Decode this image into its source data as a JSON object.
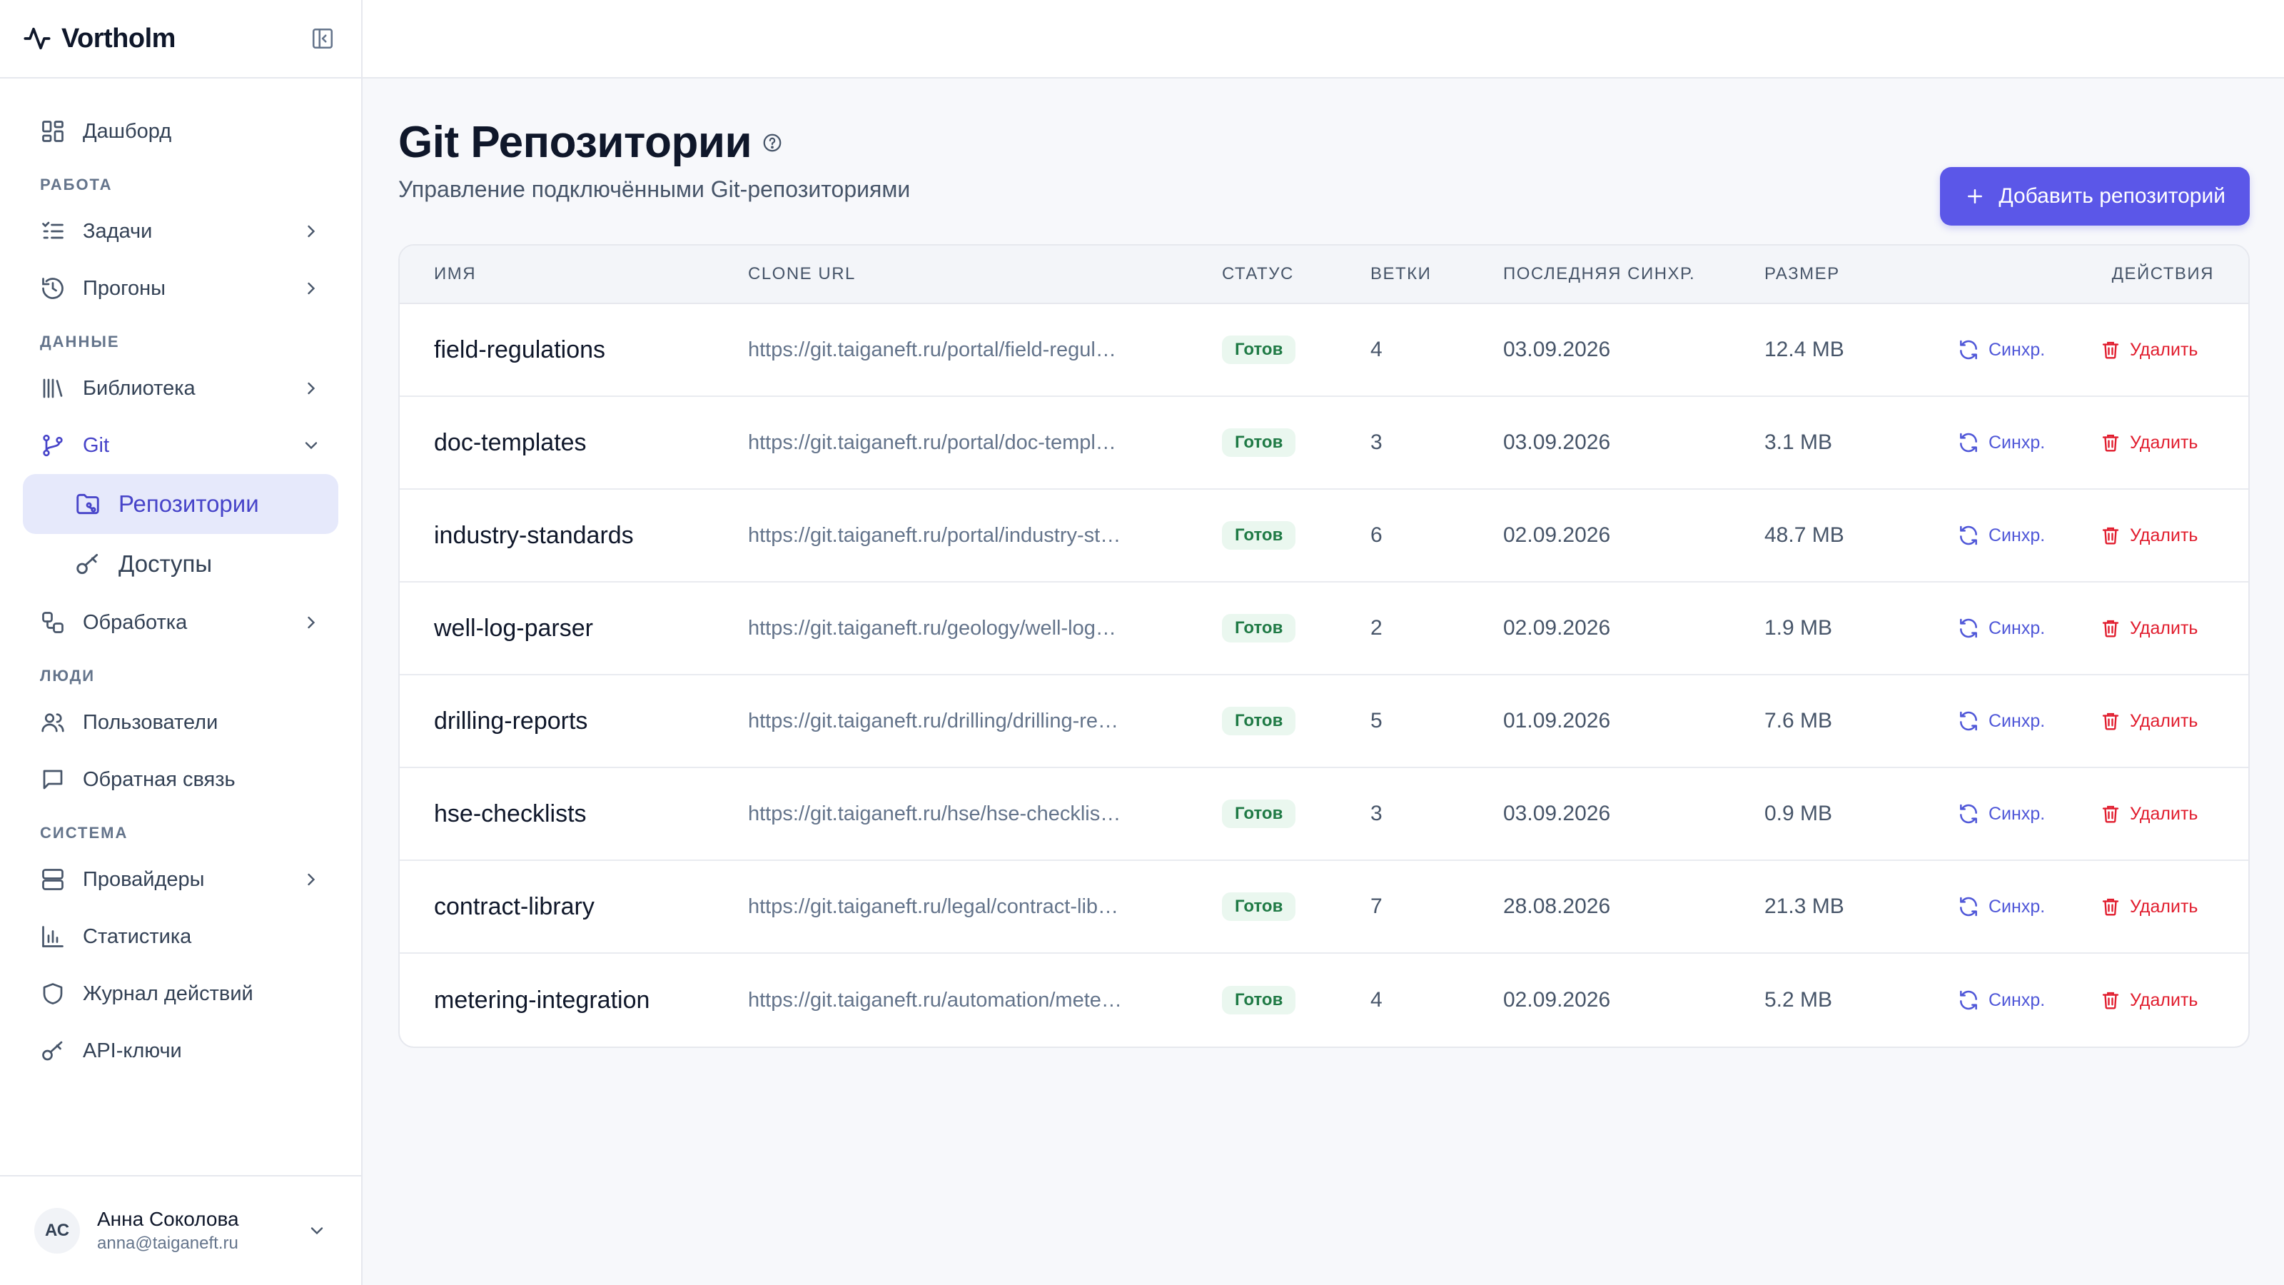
{
  "app": {
    "brand": "Vortholm"
  },
  "sidebar": {
    "items_top": [
      {
        "label": "Дашборд",
        "icon": "dashboard-icon"
      }
    ],
    "sections": [
      {
        "title": "РАБОТА",
        "items": [
          {
            "label": "Задачи",
            "icon": "tasks-icon",
            "has_chevron": true
          },
          {
            "label": "Прогоны",
            "icon": "history-icon",
            "has_chevron": true
          }
        ]
      },
      {
        "title": "ДАННЫЕ",
        "items": [
          {
            "label": "Библиотека",
            "icon": "library-icon",
            "has_chevron": true
          },
          {
            "label": "Git",
            "icon": "git-branch-icon",
            "has_chevron": true,
            "expanded": true
          },
          {
            "label": "Репозитории",
            "icon": "folder-git-icon",
            "sub": true,
            "active": true
          },
          {
            "label": "Доступы",
            "icon": "key-icon",
            "sub": true
          },
          {
            "label": "Обработка",
            "icon": "workflow-icon",
            "has_chevron": true
          }
        ]
      },
      {
        "title": "ЛЮДИ",
        "items": [
          {
            "label": "Пользователи",
            "icon": "users-icon"
          },
          {
            "label": "Обратная связь",
            "icon": "message-icon"
          }
        ]
      },
      {
        "title": "СИСТЕМА",
        "items": [
          {
            "label": "Провайдеры",
            "icon": "server-icon",
            "has_chevron": true
          },
          {
            "label": "Статистика",
            "icon": "bar-chart-icon"
          },
          {
            "label": "Журнал действий",
            "icon": "shield-icon"
          },
          {
            "label": "API-ключи",
            "icon": "key-icon"
          }
        ]
      }
    ],
    "user": {
      "initials": "АС",
      "name": "Анна Соколова",
      "email": "anna@taiganeft.ru"
    }
  },
  "page": {
    "title": "Git Репозитории",
    "subtitle": "Управление подключёнными Git-репозиториями",
    "add_button": "Добавить репозиторий"
  },
  "table": {
    "headers": {
      "name": "ИМЯ",
      "url": "CLONE URL",
      "status": "СТАТУС",
      "branches": "ВЕТКИ",
      "last_sync": "ПОСЛЕДНЯЯ СИНХР.",
      "size": "РАЗМЕР",
      "actions": "ДЕЙСТВИЯ"
    },
    "action_sync": "Синхр.",
    "action_delete": "Удалить",
    "rows": [
      {
        "name": "field-regulations",
        "url": "https://git.taiganeft.ru/portal/field-regul…",
        "status": "Готов",
        "branches": "4",
        "last_sync": "03.09.2026",
        "size": "12.4 MB"
      },
      {
        "name": "doc-templates",
        "url": "https://git.taiganeft.ru/portal/doc-templ…",
        "status": "Готов",
        "branches": "3",
        "last_sync": "03.09.2026",
        "size": "3.1 MB"
      },
      {
        "name": "industry-standards",
        "url": "https://git.taiganeft.ru/portal/industry-st…",
        "status": "Готов",
        "branches": "6",
        "last_sync": "02.09.2026",
        "size": "48.7 MB"
      },
      {
        "name": "well-log-parser",
        "url": "https://git.taiganeft.ru/geology/well-log…",
        "status": "Готов",
        "branches": "2",
        "last_sync": "02.09.2026",
        "size": "1.9 MB"
      },
      {
        "name": "drilling-reports",
        "url": "https://git.taiganeft.ru/drilling/drilling-re…",
        "status": "Готов",
        "branches": "5",
        "last_sync": "01.09.2026",
        "size": "7.6 MB"
      },
      {
        "name": "hse-checklists",
        "url": "https://git.taiganeft.ru/hse/hse-checklis…",
        "status": "Готов",
        "branches": "3",
        "last_sync": "03.09.2026",
        "size": "0.9 MB"
      },
      {
        "name": "contract-library",
        "url": "https://git.taiganeft.ru/legal/contract-lib…",
        "status": "Готов",
        "branches": "7",
        "last_sync": "28.08.2026",
        "size": "21.3 MB"
      },
      {
        "name": "metering-integration",
        "url": "https://git.taiganeft.ru/automation/mete…",
        "status": "Готов",
        "branches": "4",
        "last_sync": "02.09.2026",
        "size": "5.2 MB"
      }
    ]
  },
  "colors": {
    "accent": "#5b57e8",
    "active_bg": "#e6e9fb",
    "status_bg": "#eaf7ef",
    "status_text": "#1f7a45",
    "delete": "#e11d2e",
    "sync": "#4f57d8"
  }
}
